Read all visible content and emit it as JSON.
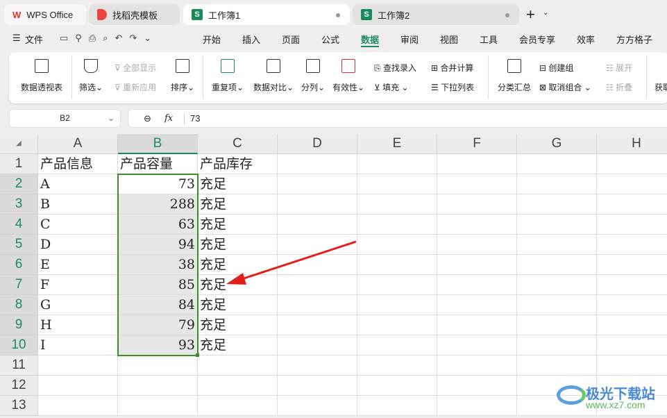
{
  "tabs": [
    {
      "label": "WPS Office"
    },
    {
      "label": "找稻壳模板"
    },
    {
      "label": "工作簿1"
    },
    {
      "label": "工作簿2"
    }
  ],
  "new_tab": "+",
  "menu": {
    "file": "文件",
    "items": [
      "开始",
      "插入",
      "页面",
      "公式",
      "数据",
      "审阅",
      "视图",
      "工具",
      "会员专享",
      "效率",
      "方方格子"
    ],
    "active": "数据"
  },
  "ribbon": {
    "pivot": "数据透视表",
    "filter": "筛选",
    "show_all": "全部显示",
    "reapply": "重新应用",
    "sort": "排序",
    "duplicates": "重复项",
    "compare": "数据对比",
    "split": "分列",
    "validity": "有效性",
    "find_entry": "查找录入",
    "fill": "填充",
    "consolidate": "合并计算",
    "dropdown": "下拉列表",
    "subtotal": "分类汇总",
    "group": "创建组",
    "ungroup": "取消组合",
    "expand": "展开",
    "collapse": "折叠",
    "get": "获取"
  },
  "formula_bar": {
    "cell_ref": "B2",
    "fx": "fx",
    "value": "73"
  },
  "sheet": {
    "columns": [
      "A",
      "B",
      "C",
      "D",
      "E",
      "F",
      "G",
      "H"
    ],
    "rows": [
      "1",
      "2",
      "3",
      "4",
      "5",
      "6",
      "7",
      "8",
      "9",
      "10",
      "11",
      "12",
      "13"
    ],
    "header": [
      "产品信息",
      "产品容量",
      "产品库存"
    ],
    "data": [
      [
        "A",
        "73",
        "充足"
      ],
      [
        "B",
        "288",
        "充足"
      ],
      [
        "C",
        "63",
        "充足"
      ],
      [
        "D",
        "94",
        "充足"
      ],
      [
        "E",
        "38",
        "充足"
      ],
      [
        "F",
        "85",
        "充足"
      ],
      [
        "G",
        "84",
        "充足"
      ],
      [
        "H",
        "79",
        "充足"
      ],
      [
        "I",
        "93",
        "充足"
      ]
    ],
    "selected_column": "B"
  },
  "watermark": {
    "name": "极光下载站",
    "url": "www.xz7.com"
  },
  "colors": {
    "accent": "#1b8a6b",
    "selection": "#3c8c2a",
    "arrow": "#e0201b"
  }
}
